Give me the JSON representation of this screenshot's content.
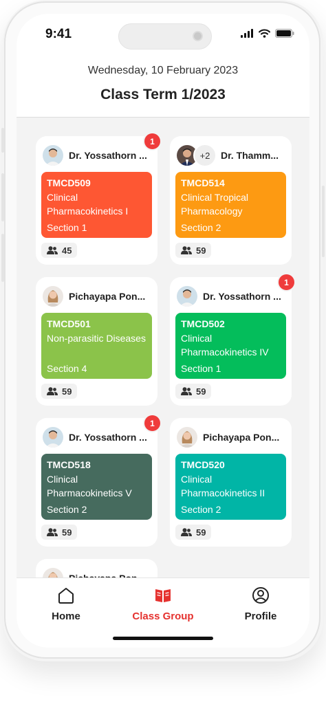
{
  "status_bar": {
    "time": "9:41"
  },
  "header": {
    "date": "Wednesday, 10 February 2023",
    "title": "Class Term 1/2023"
  },
  "cards": [
    {
      "teacher": "Dr. Yossathorn ...",
      "avatar": "male-teacher-avatar",
      "extra": "",
      "badge": "1",
      "code": "TMCD509",
      "name": "Clinical Pharmacokinetics I",
      "section": "Section 1",
      "students": "45",
      "color": "#fe5733"
    },
    {
      "teacher": "Dr. Thamm...",
      "avatar": "male-suit-avatar",
      "extra": "+2",
      "badge": "",
      "code": "TMCD514",
      "name": "Clinical Tropical Pharmacology",
      "section": "Section 2",
      "students": "59",
      "color": "#fd9a12"
    },
    {
      "teacher": "Pichayapa Pon...",
      "avatar": "female-teacher-avatar",
      "extra": "",
      "badge": "",
      "code": "TMCD501",
      "name": "Non-parasitic Diseases",
      "section": "Section 4",
      "students": "59",
      "color": "#8bc34a"
    },
    {
      "teacher": "Dr. Yossathorn ...",
      "avatar": "male-teacher-avatar",
      "extra": "",
      "badge": "1",
      "code": "TMCD502",
      "name": "Clinical Pharmacokinetics IV",
      "section": "Section 1",
      "students": "59",
      "color": "#04bd5b"
    },
    {
      "teacher": "Dr. Yossathorn ...",
      "avatar": "male-teacher-avatar",
      "extra": "",
      "badge": "1",
      "code": "TMCD518",
      "name": "Clinical Pharmacokinetics V",
      "section": "Section 2",
      "students": "59",
      "color": "#466b5e"
    },
    {
      "teacher": "Pichayapa Pon...",
      "avatar": "female-teacher-avatar",
      "extra": "",
      "badge": "",
      "code": "TMCD520",
      "name": "Clinical Pharmacokinetics II",
      "section": "Section 2",
      "students": "59",
      "color": "#01b5a6"
    },
    {
      "teacher": "Pichayapa Pon...",
      "avatar": "female-teacher-avatar",
      "extra": "",
      "badge": "",
      "code": "",
      "name": "",
      "section": "",
      "students": "",
      "color": "#cccccc"
    }
  ],
  "tab_bar": {
    "items": [
      {
        "label": "Home",
        "icon": "home-icon",
        "active": false
      },
      {
        "label": "Class Group",
        "icon": "book-icon",
        "active": true
      },
      {
        "label": "Profile",
        "icon": "profile-icon",
        "active": false
      }
    ]
  },
  "colors": {
    "accent": "#e5322f",
    "badge": "#ef3b3b"
  }
}
